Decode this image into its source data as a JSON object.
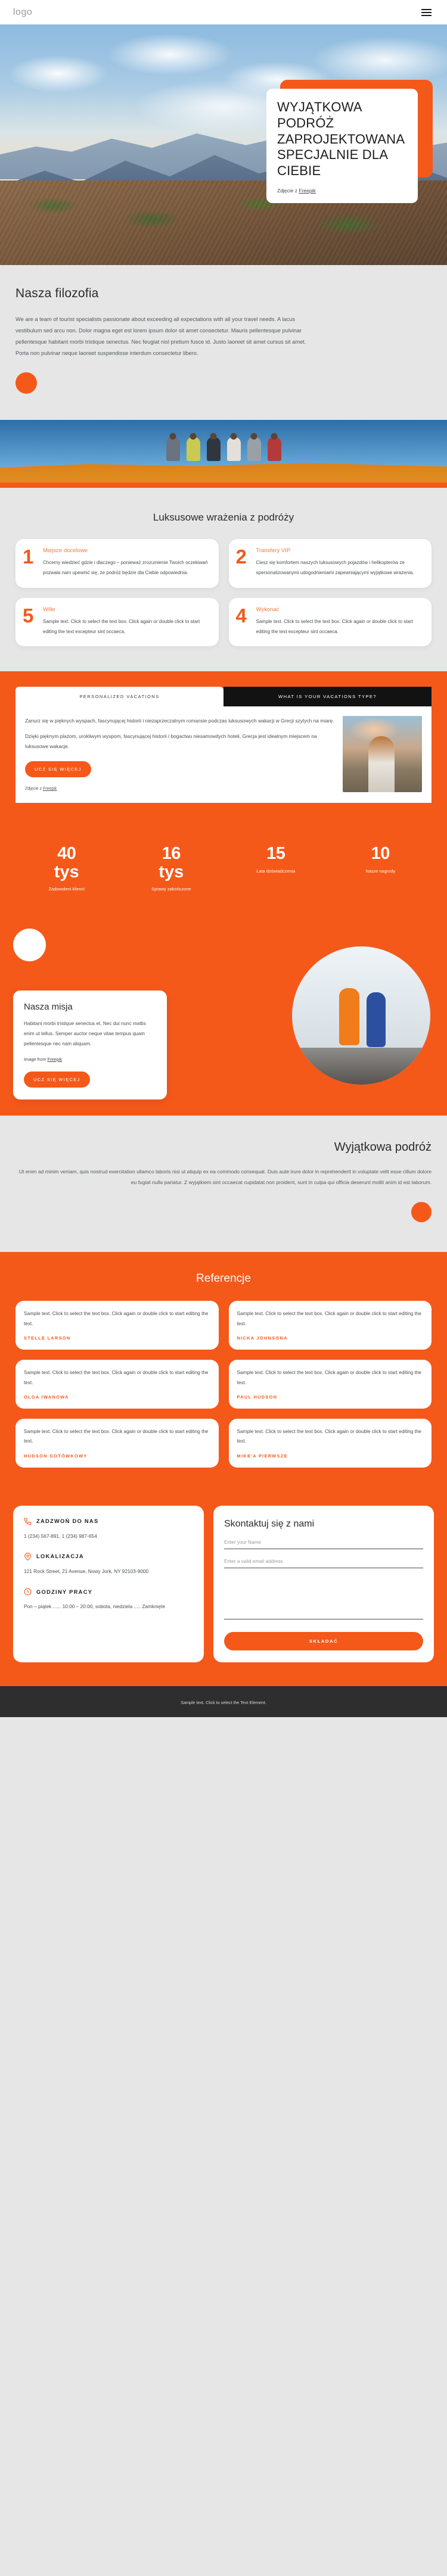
{
  "header": {
    "logo": "logo",
    "menu_icon": "hamburger-menu-icon"
  },
  "hero": {
    "title": "WYJĄTKOWA PODRÓŻ ZAPROJEKTOWANA SPECJALNIE DLA CIEBIE",
    "credit_prefix": "Zdjęcie z ",
    "credit_link": "Freepik"
  },
  "philosophy": {
    "title": "Nasza filozofia",
    "body": "We are a team of tourist specialists passionate about exceeding all expectations with all your travel needs. A lacus vestibulum sed arcu non. Dolor magna eget est lorem ipsum dolor sit amet consectetur. Mauris pellentesque pulvinar pellentesque habitant morbi tristique senectus. Nec feugiat nisl pretium fusce id. Justo laoreet sit amet cursus sit amet. Porta non pulvinar neque laoreet suspendisse interdum consectetur libero."
  },
  "luxury": {
    "title": "Luksusowe wrażenia z podróży",
    "cards": [
      {
        "num": "1",
        "title": "Miejsce docelowe",
        "text": "Chcemy wiedzieć gdzie i dlaczego – ponieważ zrozumienie Twoich oczekiwań pozwala nam upewnić się, że podróż będzie dla Ciebie odpowiednia."
      },
      {
        "num": "2",
        "title": "Transfery VIP",
        "text": "Ciesz się komfortem naszych luksusowych pojazdów i helikopterów ze spersonalizowanymi udogodnieniami zapewniającymi wyjątkowe wrażenia."
      },
      {
        "num": "5",
        "title": "Wille",
        "text": "Sample text. Click to select the text box. Click again or double click to start editing the text excepteur sint occaeca."
      },
      {
        "num": "4",
        "title": "Wykonać",
        "text": "Sample text. Click to select the text box. Click again or double click to start editing the text excepteur sint occaeca."
      }
    ]
  },
  "personalized": {
    "tab_active": "PERSONALIZED VACATIONS",
    "tab_inactive": "WHAT IS YOUR VACATIONS TYPE?",
    "paragraph1": "Zanurz się w pięknych wyspach, fascynującej historii i niezaprzeczalnym romansie podczas luksusowych wakacji w Grecji szytych na miarę.",
    "paragraph2": "Dzięki pięknym plażom, urokliwym wyspom, fascynującej historii i bogactwu niesamowitych hoteli, Grecja jest idealnym miejscem na luksusowe wakacje.",
    "button": "UCZ SIĘ WIĘCEJ",
    "credit_prefix": "Zdjęcie z ",
    "credit_link": "Freepik"
  },
  "stats": [
    {
      "num": "40",
      "unit": "tys",
      "label": "Zadowoleni klienci"
    },
    {
      "num": "16",
      "unit": "tys",
      "label": "Sprawy zakończone"
    },
    {
      "num": "15",
      "unit": "",
      "label": "Lata doświadczenia"
    },
    {
      "num": "10",
      "unit": "",
      "label": "Nasze nagrody"
    }
  ],
  "mission": {
    "title": "Nasza misja",
    "body": "Habitant morbi tristique senectus et. Nec dui nunc mattis enim ut tellus. Semper auctor neque vitae tempus quam pellentesque nec nam aliquam.",
    "credit_prefix": "Image from ",
    "credit_link": "Freepik",
    "button": "UCZ SIĘ WIĘCEJ"
  },
  "exceptional": {
    "title": "Wyjątkowa podróż",
    "body": "Ut enim ad minim veniam, quis nostrud exercitation ullamco laboris nisi ut aliquip ex ea commodo consequat. Duis aute irure dolor in reprehenderit in voluptate velit esse cillum dolore eu fugiat nulla pariatur. Z wyjątkiem sint occaecat cupidatat non proident, sunt in culpa qui officia deserunt mollit anim id est laborum."
  },
  "testimonials": {
    "title": "Referencje",
    "items": [
      {
        "text": "Sample text. Click to select the text box. Click again or double click to start editing the text.",
        "who": "STELLĘ LARSON"
      },
      {
        "text": "Sample text. Click to select the text box. Click again or double click to start editing the text.",
        "who": "NICKA JOHNSONA"
      },
      {
        "text": "Sample text. Click to select the text box. Click again or double click to start editing the text.",
        "who": "OLGA IWANOWA"
      },
      {
        "text": "Sample text. Click to select the text box. Click again or double click to start editing the text.",
        "who": "PAUL HUDSON"
      },
      {
        "text": "Sample text. Click to select the text box. Click again or double click to start editing the text.",
        "who": "HUDSON GOTÓWKOWY"
      },
      {
        "text": "Sample text. Click to select the text box. Click again or double click to start editing the text.",
        "who": "MIKE'A PIERWSZE"
      }
    ]
  },
  "contact": {
    "phone_head": "ZADZWOŃ DO NAS",
    "phone_icon": "phone-icon",
    "phone_text": "1 (234) 567-891, 1 (234) 987-654",
    "location_head": "LOKALIZACJA",
    "location_icon": "map-pin-icon",
    "location_text": "121 Rock Street, 21 Avenue, Nowy Jork, NY 92103-9000",
    "hours_head": "GODZINY PRACY",
    "hours_icon": "clock-icon",
    "hours_text": "Pon – piątek ...... 10:00 – 20:00, sobota, niedziela ..... Zamknięte",
    "form_title": "Skontaktuj się z nami",
    "name_placeholder": "Enter your Name",
    "email_placeholder": "Enter a valid email address",
    "message_placeholder": "",
    "submit": "SKŁADAĆ"
  },
  "footer": {
    "text": "Sample text. Click to select the Text Element."
  },
  "colors": {
    "accent": "#f4591a",
    "bg": "#e6e6e6",
    "dark": "#2e2e2e"
  }
}
